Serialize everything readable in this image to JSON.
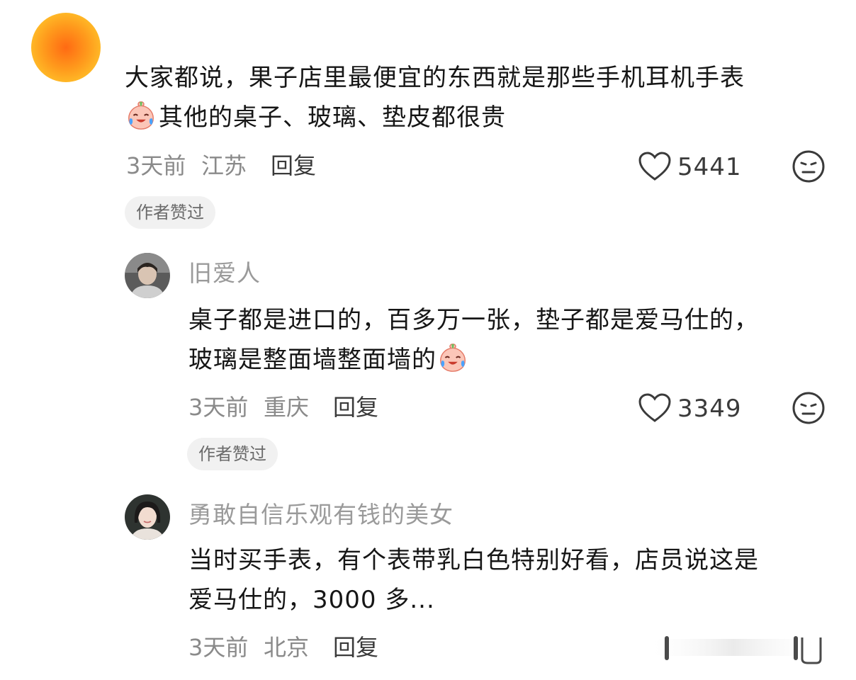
{
  "comments": [
    {
      "text_line1": "大家都说，果子店里最便宜的东西就是那些手机耳机手表",
      "text_line2": "其他的桌子、玻璃、垫皮都很贵",
      "time": "3天前",
      "location": "江苏",
      "reply_label": "回复",
      "likes": "5441",
      "tag": "作者赞过"
    }
  ],
  "replies": [
    {
      "username": "旧爱人",
      "text_line1": "桌子都是进口的，百多万一张，垫子都是爱马仕的，",
      "text_line2": "玻璃是整面墙整面墙的",
      "time": "3天前",
      "location": "重庆",
      "reply_label": "回复",
      "likes": "3349",
      "tag": "作者赞过"
    },
    {
      "username": "勇敢自信乐观有钱的美女",
      "text_line1": "当时买手表，有个表带乳白色特别好看，店员说这是",
      "text_line2": "爱马仕的，3000 多...",
      "time": "3天前",
      "location": "北京",
      "reply_label": "回复"
    }
  ],
  "icons": {
    "like": "heart-outline-icon",
    "dislike": "neutral-face-icon",
    "emoji": "crying-laughing-peach-emoji"
  },
  "colors": {
    "meta_gray": "#8a8a8a",
    "username_gray": "#9a9a9a",
    "tag_bg": "#f1f1f1",
    "avatar_orange": "#ff8a1a"
  }
}
